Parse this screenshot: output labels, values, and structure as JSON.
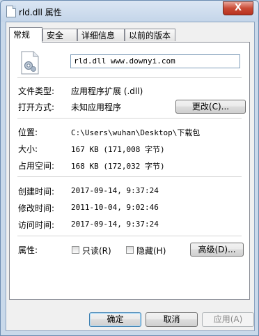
{
  "window": {
    "title": "rld.dll 属性",
    "close_symbol": "X"
  },
  "tabs": [
    {
      "label": "常规",
      "active": true
    },
    {
      "label": "安全",
      "active": false
    },
    {
      "label": "详细信息",
      "active": false
    },
    {
      "label": "以前的版本",
      "active": false
    }
  ],
  "general": {
    "file_name": "rld.dll www.downyi.com",
    "file_type_label": "文件类型:",
    "file_type_value": "应用程序扩展 (.dll)",
    "opens_with_label": "打开方式:",
    "opens_with_value": "未知应用程序",
    "change_button": "更改(C)...",
    "location_label": "位置:",
    "location_value": "C:\\Users\\wuhan\\Desktop\\下载包",
    "size_label": "大小:",
    "size_value": "167 KB (171,008 字节)",
    "size_on_disk_label": "占用空间:",
    "size_on_disk_value": "168 KB (172,032 字节)",
    "created_label": "创建时间:",
    "created_value": "2017-09-14, 9:37:24",
    "modified_label": "修改时间:",
    "modified_value": "2011-10-04, 9:02:46",
    "accessed_label": "访问时间:",
    "accessed_value": "2017-09-14, 9:37:24",
    "attributes_label": "属性:",
    "readonly_label": "只读(R)",
    "readonly_checked": false,
    "hidden_label": "隐藏(H)",
    "hidden_checked": false,
    "advanced_button": "高级(D)..."
  },
  "footer": {
    "ok_button": "确定",
    "cancel_button": "取消",
    "apply_button": "应用(A)"
  }
}
